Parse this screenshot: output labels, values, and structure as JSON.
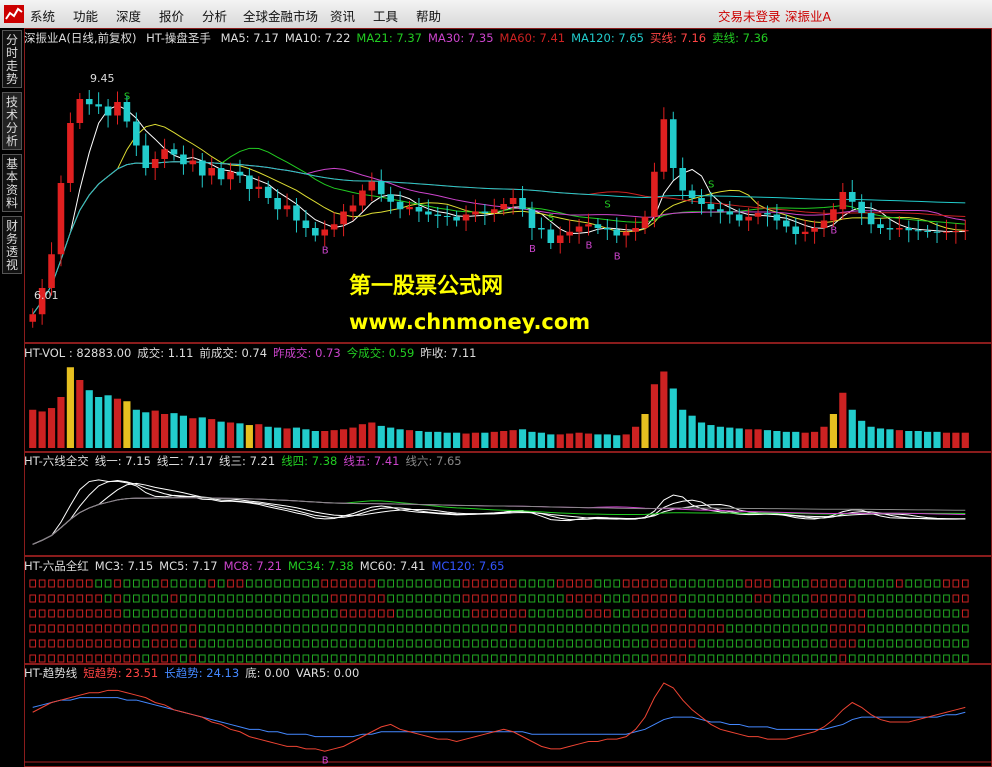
{
  "menubar": {
    "items": [
      "系统",
      "功能",
      "深度",
      "报价",
      "分析",
      "全球金融市场",
      "资讯",
      "工具",
      "帮助"
    ],
    "trade_status": "交易未登录",
    "stock_title": "深振业A"
  },
  "side_tabs": [
    "分时走势",
    "技术分析",
    "基本资料",
    "财务透视"
  ],
  "watermark": {
    "line1": "第一股票公式网",
    "line2": "www.chnmoney.com"
  },
  "price_panel": {
    "stock": "深振业A(日线,前复权)",
    "indicator": "HT-操盘圣手",
    "values": [
      {
        "label": "MA5: 7.17",
        "color": "#dddddd"
      },
      {
        "label": "MA10: 7.22",
        "color": "#dddddd"
      },
      {
        "label": "MA21: 7.37",
        "color": "#22cc22"
      },
      {
        "label": "MA30: 7.35",
        "color": "#cc44cc"
      },
      {
        "label": "MA60: 7.41",
        "color": "#cc2222"
      },
      {
        "label": "MA120: 7.65",
        "color": "#22cccc"
      },
      {
        "label": "买线: 7.16",
        "color": "#ff4444"
      },
      {
        "label": "卖线: 7.36",
        "color": "#22cc22"
      }
    ],
    "high_label": "9.45",
    "low_label": "6.01",
    "signal_s": "S",
    "signal_b": "B"
  },
  "chart_data": {
    "type": "candlestick",
    "close": [
      6.15,
      6.5,
      6.95,
      7.9,
      8.7,
      9.02,
      8.95,
      8.92,
      8.8,
      8.98,
      8.72,
      8.4,
      8.1,
      8.22,
      8.35,
      8.28,
      8.15,
      8.2,
      8.0,
      8.1,
      7.95,
      8.05,
      8.0,
      7.82,
      7.85,
      7.7,
      7.55,
      7.6,
      7.4,
      7.3,
      7.2,
      7.28,
      7.35,
      7.52,
      7.6,
      7.8,
      7.92,
      7.75,
      7.65,
      7.55,
      7.58,
      7.52,
      7.48,
      7.46,
      7.45,
      7.4,
      7.48,
      7.52,
      7.5,
      7.55,
      7.62,
      7.7,
      7.55,
      7.3,
      7.28,
      7.1,
      7.2,
      7.25,
      7.32,
      7.35,
      7.3,
      7.28,
      7.2,
      7.25,
      7.3,
      7.45,
      8.05,
      8.75,
      8.1,
      7.8,
      7.7,
      7.62,
      7.55,
      7.52,
      7.48,
      7.4,
      7.45,
      7.5,
      7.48,
      7.4,
      7.32,
      7.22,
      7.25,
      7.3,
      7.4,
      7.55,
      7.78,
      7.65,
      7.5,
      7.35,
      7.3,
      7.28,
      7.3,
      7.27,
      7.26,
      7.25,
      7.24,
      7.25,
      7.26,
      7.27
    ],
    "volume": [
      45000,
      43000,
      47000,
      60000,
      95000,
      80000,
      68000,
      60000,
      62000,
      58000,
      55000,
      45000,
      42000,
      44000,
      40000,
      41000,
      38000,
      35000,
      36000,
      34000,
      31000,
      30000,
      29000,
      27000,
      28000,
      25000,
      24000,
      23000,
      24000,
      22000,
      20000,
      20000,
      21000,
      22000,
      24000,
      28000,
      30000,
      26000,
      24000,
      22000,
      21000,
      20000,
      19000,
      19000,
      18000,
      18000,
      17000,
      18000,
      18000,
      19000,
      20000,
      21000,
      22000,
      19000,
      18000,
      16000,
      16000,
      17000,
      18000,
      17000,
      16000,
      16000,
      15000,
      16000,
      25000,
      40000,
      75000,
      90000,
      70000,
      45000,
      38000,
      30000,
      27000,
      25000,
      24000,
      23000,
      22000,
      22000,
      21000,
      20000,
      19000,
      19000,
      18000,
      19000,
      25000,
      40000,
      65000,
      45000,
      32000,
      25000,
      23000,
      22000,
      21000,
      20000,
      20000,
      19000,
      19000,
      18000,
      18000,
      18000
    ],
    "ma": [
      {
        "name": "MA5",
        "value": 7.17
      },
      {
        "name": "MA10",
        "value": 7.22
      },
      {
        "name": "MA21",
        "value": 7.37
      },
      {
        "name": "MA30",
        "value": 7.35
      },
      {
        "name": "MA60",
        "value": 7.41
      },
      {
        "name": "MA120",
        "value": 7.65
      }
    ],
    "price_range": [
      5.9,
      9.7
    ]
  },
  "vol_panel": {
    "values": [
      {
        "label": "HT-VOL : 82883.00",
        "color": "#dddddd"
      },
      {
        "label": "成交: 1.11",
        "color": "#dddddd"
      },
      {
        "label": "前成交: 0.74",
        "color": "#dddddd"
      },
      {
        "label": "昨成交: 0.73",
        "color": "#cc44cc"
      },
      {
        "label": "今成交: 0.59",
        "color": "#22cc22"
      },
      {
        "label": "昨收: 7.11",
        "color": "#dddddd"
      }
    ]
  },
  "six_line_panel": {
    "values": [
      {
        "label": "HT-六线全交",
        "color": "#dddddd"
      },
      {
        "label": "线一: 7.15",
        "color": "#dddddd"
      },
      {
        "label": "线二: 7.17",
        "color": "#dddddd"
      },
      {
        "label": "线三: 7.21",
        "color": "#dddddd"
      },
      {
        "label": "线四: 7.38",
        "color": "#22cc22"
      },
      {
        "label": "线五: 7.41",
        "color": "#cc44cc"
      },
      {
        "label": "线六: 7.65",
        "color": "#888888"
      }
    ]
  },
  "six_red_panel": {
    "values": [
      {
        "label": "HT-六品全红",
        "color": "#dddddd"
      },
      {
        "label": "MC3: 7.15",
        "color": "#dddddd"
      },
      {
        "label": "MC5: 7.17",
        "color": "#dddddd"
      },
      {
        "label": "MC8: 7.21",
        "color": "#cc44cc"
      },
      {
        "label": "MC34: 7.38",
        "color": "#22cc22"
      },
      {
        "label": "MC60: 7.41",
        "color": "#dddddd"
      },
      {
        "label": "MC120: 7.65",
        "color": "#3355ff"
      }
    ]
  },
  "trend_panel": {
    "values": [
      {
        "label": "HT-趋势线",
        "color": "#dddddd"
      },
      {
        "label": "短趋势: 23.51",
        "color": "#ff4444"
      },
      {
        "label": "长趋势: 24.13",
        "color": "#4488ff"
      },
      {
        "label": "底: 0.00",
        "color": "#dddddd"
      },
      {
        "label": "VAR5: 0.00",
        "color": "#dddddd"
      }
    ],
    "bottom_mark": "B",
    "short_trend": [
      20,
      22,
      24,
      25,
      26,
      27,
      28,
      28,
      29,
      29,
      28,
      27,
      26,
      24,
      23,
      21,
      20,
      19,
      18,
      16,
      15,
      13,
      12,
      10,
      9,
      8,
      7,
      6,
      6,
      5,
      5,
      4,
      5,
      6,
      8,
      10,
      12,
      14,
      15,
      13,
      12,
      11,
      10,
      9,
      9,
      8,
      9,
      10,
      11,
      12,
      13,
      12,
      10,
      8,
      6,
      5,
      5,
      6,
      7,
      8,
      8,
      9,
      9,
      10,
      13,
      18,
      26,
      32,
      30,
      25,
      21,
      18,
      15,
      13,
      12,
      11,
      10,
      10,
      9,
      9,
      9,
      10,
      11,
      12,
      14,
      17,
      21,
      24,
      22,
      19,
      17,
      16,
      16,
      16,
      17,
      18,
      19,
      20,
      21,
      22
    ],
    "long_trend": [
      22,
      23,
      24,
      25,
      25,
      26,
      26,
      26,
      26,
      26,
      25,
      25,
      24,
      23,
      22,
      21,
      20,
      19,
      18,
      17,
      16,
      15,
      14,
      13,
      13,
      12,
      12,
      11,
      11,
      11,
      10,
      10,
      10,
      10,
      10,
      11,
      11,
      12,
      12,
      12,
      12,
      12,
      12,
      12,
      12,
      12,
      12,
      12,
      12,
      12,
      12,
      12,
      12,
      11,
      11,
      11,
      11,
      11,
      11,
      11,
      11,
      11,
      11,
      11,
      12,
      13,
      15,
      17,
      18,
      18,
      18,
      17,
      16,
      16,
      15,
      15,
      14,
      14,
      14,
      13,
      13,
      13,
      13,
      13,
      13,
      14,
      15,
      17,
      18,
      18,
      18,
      18,
      18,
      18,
      18,
      18,
      18,
      19,
      19,
      20
    ]
  }
}
